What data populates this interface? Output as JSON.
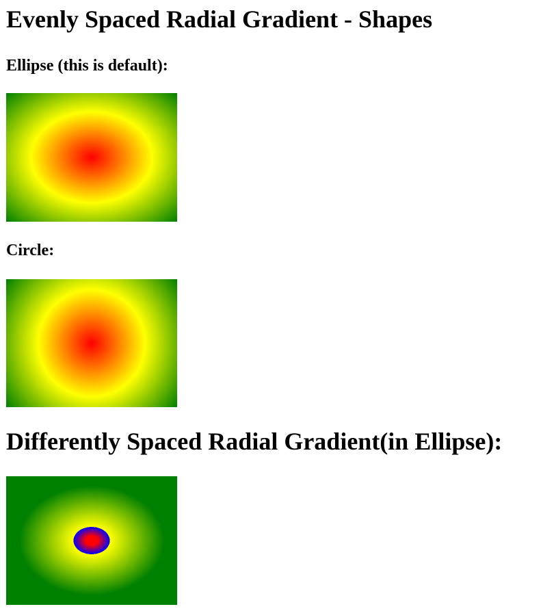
{
  "headings": {
    "main": "Evenly Spaced Radial Gradient - Shapes",
    "ellipse": "Ellipse (this is default):",
    "circle": "Circle:",
    "different": "Differently Spaced Radial Gradient(in Ellipse):"
  },
  "gradients": {
    "ellipse": {
      "shape": "ellipse",
      "colors": [
        "#ff0000",
        "#ffff00",
        "#008000"
      ]
    },
    "circle": {
      "shape": "circle",
      "colors": [
        "#ff0000",
        "#ffff00",
        "#008000"
      ]
    },
    "different": {
      "shape": "ellipse",
      "colors": [
        "#ff0000",
        "#0000ff",
        "#ffff00",
        "#008000"
      ]
    }
  }
}
